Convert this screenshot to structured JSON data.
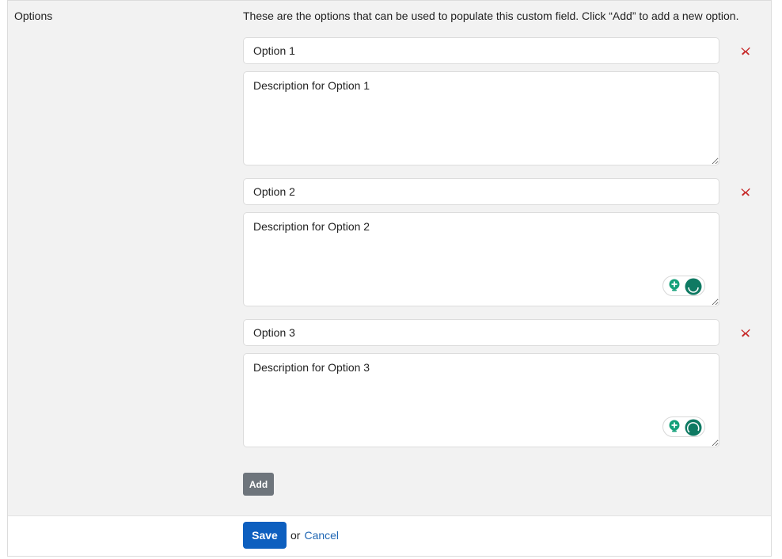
{
  "field": {
    "label": "Options",
    "help_text": "These are the options that can be used to populate this custom field. Click “Add” to add a new option."
  },
  "options": [
    {
      "name": "Option 1",
      "description": "Description for Option 1"
    },
    {
      "name": "Option 2",
      "description": "Description for Option 2"
    },
    {
      "name": "Option 3",
      "description": "Description for Option 3"
    }
  ],
  "add_label": "Add",
  "footer": {
    "save_label": "Save",
    "or_text": "or",
    "cancel_label": "Cancel"
  },
  "icons": {
    "remove": "remove-x-icon",
    "assistant_bulb": "lightbulb-icon",
    "assistant_logo": "grammar-assistant-icon"
  },
  "colors": {
    "panel_bg": "#f2f2f2",
    "remove_red": "#c62828",
    "save_blue": "#0d5fbf",
    "add_gray": "#6e757c",
    "link_blue": "#1f66b3",
    "assistant_green": "#15a07a"
  }
}
